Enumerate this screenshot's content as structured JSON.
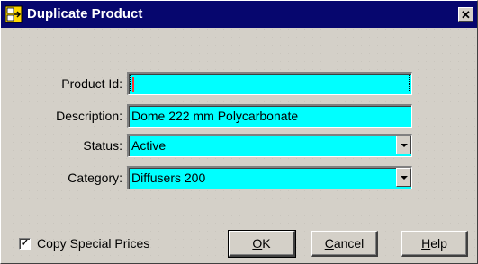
{
  "window": {
    "title": "Duplicate Product",
    "close_glyph": "✕",
    "icon": "app-icon"
  },
  "form": {
    "product_id": {
      "label": "Product Id:",
      "value": ""
    },
    "description": {
      "label": "Description:",
      "value": "Dome 222 mm Polycarbonate"
    },
    "status": {
      "label": "Status:",
      "value": "Active"
    },
    "category": {
      "label": "Category:",
      "value": "Diffusers 200"
    }
  },
  "options": {
    "copy_special_prices": {
      "label": "Copy Special Prices",
      "checked": true,
      "mark": "✓"
    }
  },
  "buttons": {
    "ok": {
      "mnemonic": "O",
      "rest": "K"
    },
    "cancel": {
      "mnemonic": "C",
      "rest": "ancel"
    },
    "help": {
      "mnemonic": "H",
      "rest": "elp"
    }
  },
  "colors": {
    "titlebar": "#06066e",
    "field_background": "#00ffff",
    "dialog_background": "#d4d0c8"
  }
}
